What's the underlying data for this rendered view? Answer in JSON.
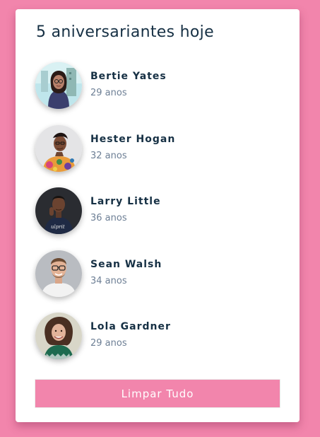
{
  "card": {
    "title": "5 aniversariantes hoje"
  },
  "people": [
    {
      "name": "Bertie Yates",
      "age": "29 anos",
      "avatar": "woman-glasses-beach-photo"
    },
    {
      "name": "Hester Hogan",
      "age": "32 anos",
      "avatar": "woman-floral-dress-photo"
    },
    {
      "name": "Larry Little",
      "age": "36 anos",
      "avatar": "man-dark-tshirt-photo"
    },
    {
      "name": "Sean Walsh",
      "age": "34 anos",
      "avatar": "man-glasses-beard-photo"
    },
    {
      "name": "Lola Gardner",
      "age": "29 anos",
      "avatar": "woman-curly-hair-photo"
    }
  ],
  "actions": {
    "clear_label": "Limpar Tudo"
  },
  "colors": {
    "background": "#f285ac",
    "card": "#ffffff",
    "title_text": "#163044",
    "age_text": "#6d7f95",
    "button": "#f285ac"
  }
}
